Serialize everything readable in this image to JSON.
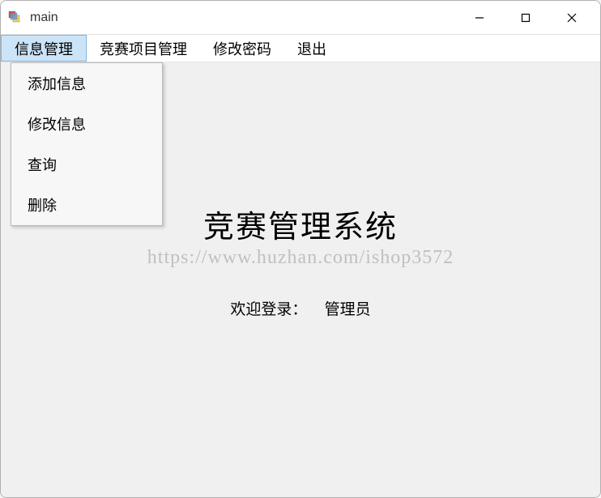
{
  "window": {
    "title": "main"
  },
  "menubar": {
    "items": [
      {
        "label": "信息管理"
      },
      {
        "label": "竞赛项目管理"
      },
      {
        "label": "修改密码"
      },
      {
        "label": "退出"
      }
    ]
  },
  "dropdown": {
    "items": [
      {
        "label": "添加信息"
      },
      {
        "label": "修改信息"
      },
      {
        "label": "查询"
      },
      {
        "label": "删除"
      }
    ]
  },
  "content": {
    "main_title": "竞赛管理系统",
    "watermark": "https://www.huzhan.com/ishop3572",
    "welcome_label": "欢迎登录：",
    "welcome_user": "管理员"
  }
}
